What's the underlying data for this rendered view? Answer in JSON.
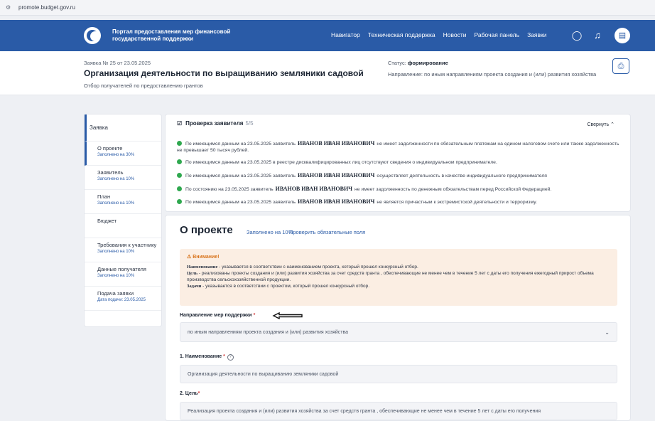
{
  "browser": {
    "url": "promote.budget.gov.ru"
  },
  "header": {
    "portal_title": "Портал предоставления мер финансовой государственной поддержки",
    "nav": [
      "Навигатор",
      "Техническая поддержка",
      "Новости",
      "Рабочая панель",
      "Заявки"
    ]
  },
  "application": {
    "number": "Заявка № 25 от 23.05.2025",
    "title": "Организация деятельности по выращиванию земляники садовой",
    "subtitle": "Отбор получателей по предоставлению грантов",
    "status_label": "Статус:",
    "status_value": "формирование",
    "direction": "Направление: по иным направлениям проекта создания и (или) развития хозяйства"
  },
  "sidebar": {
    "header": "Заявка",
    "items": [
      {
        "label": "О проекте",
        "note": "Заполнено на 30%"
      },
      {
        "label": "Заявитель",
        "note": "Заполнено на 10%"
      },
      {
        "label": "План",
        "note": "Заполнено на 10%"
      },
      {
        "label": "Бюджет",
        "note": ""
      },
      {
        "label": "Требования к участнику",
        "note": "Заполнено на 10%"
      },
      {
        "label": "Данные получателя",
        "note": "Заполнено на 10%"
      },
      {
        "label": "Подача заявки",
        "note": "Дата подачи: 23.05.2025"
      }
    ]
  },
  "check": {
    "title": "Проверка заявителя",
    "count": "5/5",
    "collapse": "Свернуть",
    "name": "ИВАНОВ ИВАН ИВАНОВИЧ",
    "lines": [
      {
        "pre": "По имеющимся данным на 23.05.2025 заявитель",
        "post": "не имеет задолженности по обязательным платежам на едином налоговом счете или также задолженность не превышает 50 тысяч рублей."
      },
      {
        "pre": "По имеющимся данным на 23.05.2025 в реестре дисквалифицированных лиц отсутствуют сведения о индивидуальном предпринимателе.",
        "post": ""
      },
      {
        "pre": "По имеющимся данным на 23.05.2025 заявитель",
        "post": "осуществляет деятельность в качестве индивидуального предпринимателя"
      },
      {
        "pre": "По состоянию на 23.05.2025 заявитель",
        "post": "не имеет задолженность по денежным обязательствам перед Российской Федерацией."
      },
      {
        "pre": "По имеющимся данным на 23.05.2025 заявитель",
        "post": "не является причастным к экстремистской деятельности и терроризму."
      }
    ]
  },
  "about": {
    "title": "О проекте",
    "fill": "Заполнено на 10%",
    "check_link": "Проверить обязательные поля",
    "warning_title": "Внимание!",
    "warning_lines": [
      {
        "bold": "Наименование",
        "text": " - указывается в соответствии с наименованием проекта, который прошел конкурсный отбор."
      },
      {
        "bold": "Цель",
        "text": " - реализованы проекты создания и (или) развития хозяйства за счет средств гранта , обеспечивающие не менее чем в течение 5 лет с даты его получения ежегодный прирост объема производства сельскохозяйственной продукции."
      },
      {
        "bold": "Задачи",
        "text": " - указывается в соответствии с проектом, который прошел конкурсный отбор."
      }
    ],
    "direction_label": "Направление мер поддержки",
    "direction_value": "по иным направлениям проекта создания и (или) развития хозяйства",
    "name_label": "1. Наименование",
    "name_value": "Организация деятельности по выращиванию земляники садовой",
    "goal_label": "2. Цель",
    "goal_value": "Реализация проекта создания и (или) развития хозяйства за счет средств гранта , обеспечивающие не менее чем в течение 5 лет с даты его получения"
  }
}
